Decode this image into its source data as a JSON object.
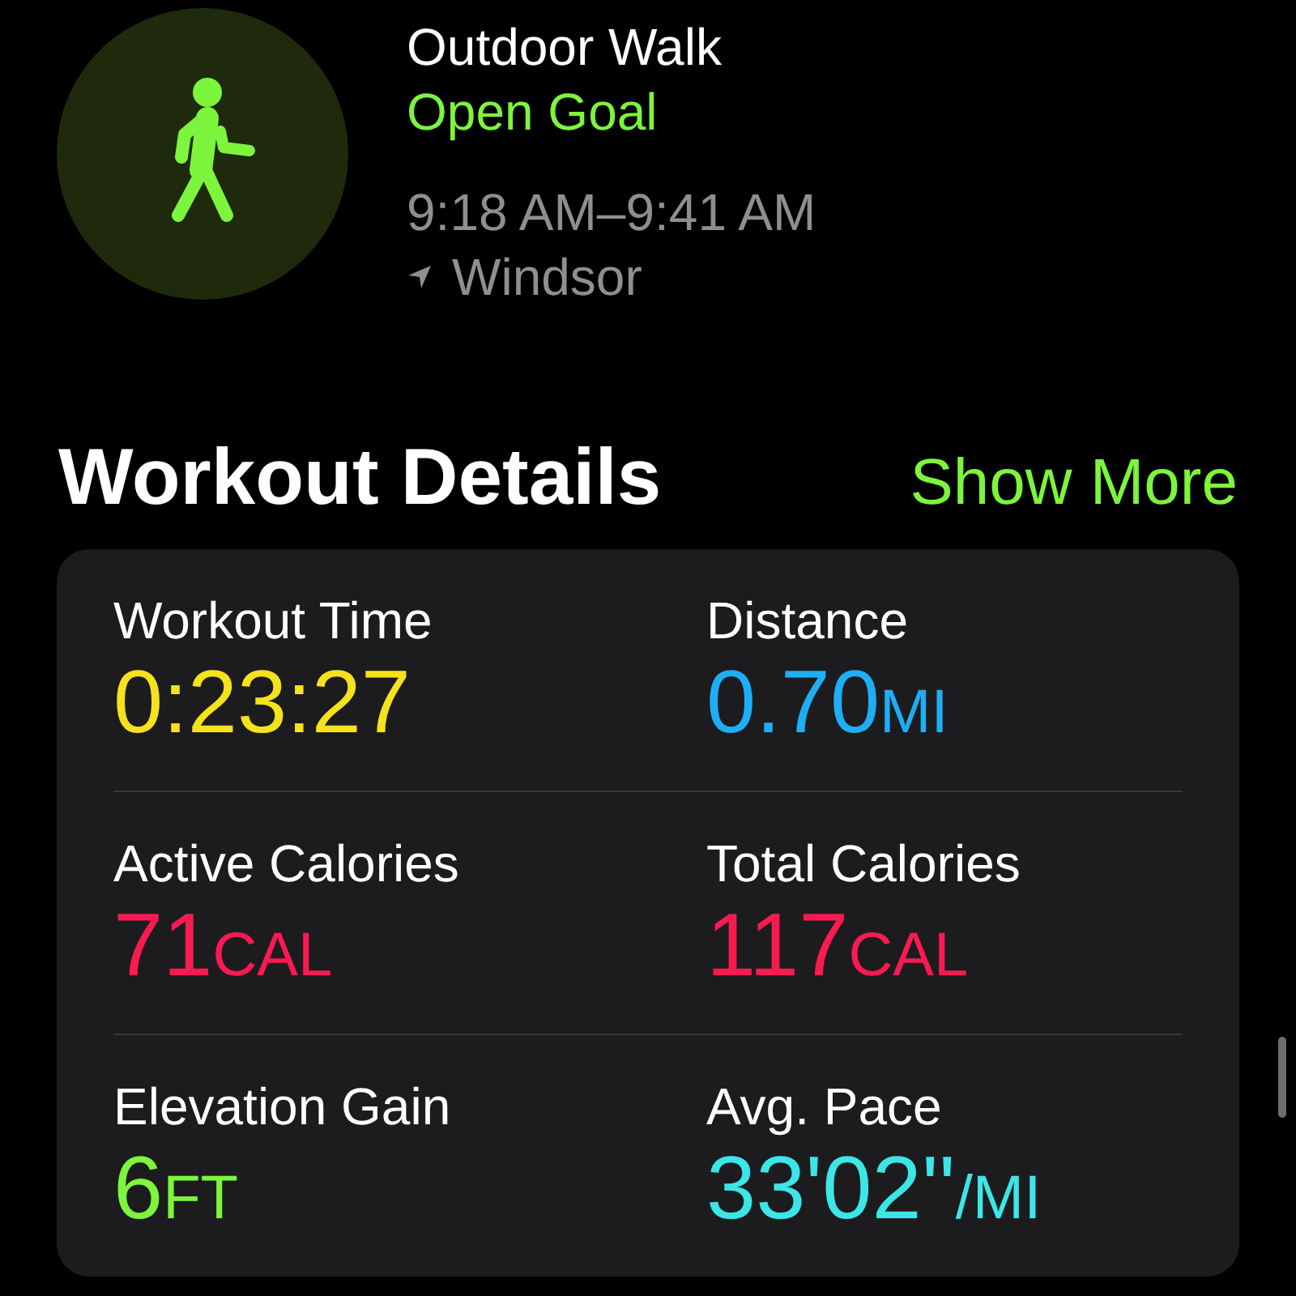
{
  "workout": {
    "title": "Outdoor Walk",
    "goal": "Open Goal",
    "time_range": "9:18 AM–9:41 AM",
    "location": "Windsor"
  },
  "section": {
    "title": "Workout Details",
    "action": "Show More"
  },
  "metrics": [
    {
      "label": "Workout Time",
      "value": "0:23:27",
      "color": "#f5e11d"
    },
    {
      "label": "Distance",
      "value": "0.70",
      "unit": "MI",
      "color": "#1eaef5"
    },
    {
      "label": "Active Calories",
      "value": "71",
      "unit": "CAL",
      "color": "#fa1a52"
    },
    {
      "label": "Total Calories",
      "value": "117",
      "unit": "CAL",
      "color": "#fa1a52"
    },
    {
      "label": "Elevation Gain",
      "value": "6",
      "unit": "FT",
      "color": "#7cf53c"
    },
    {
      "label": "Avg. Pace",
      "value": "33'02''",
      "unit": "/MI",
      "color": "#3ce6e6"
    }
  ]
}
